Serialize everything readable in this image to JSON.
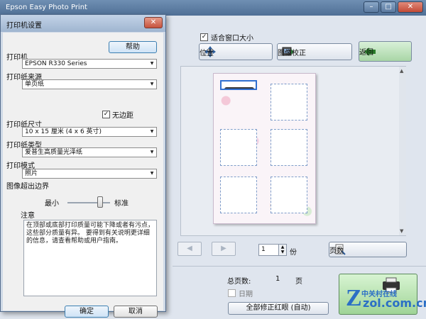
{
  "app": {
    "title": "Epson Easy Photo Print",
    "window_buttons": {
      "minimize": "–",
      "maximize": "□",
      "close": "✕"
    }
  },
  "toolbar": {
    "fit_window_label": "适合窗口大小",
    "fit_window_checked": "✓",
    "position_label": "位置",
    "correct_label": "图像校正",
    "back_label": "返回"
  },
  "navigation": {
    "prev_arrow": "◀",
    "next_arrow": "▶",
    "copies_value": "1",
    "copies_unit": "份",
    "pages_label": "页数"
  },
  "summary": {
    "total_pages_label": "总页数:",
    "total_pages_value": "1",
    "total_pages_unit": "页",
    "date_label": "日期",
    "redeye_label": "全部修正红眼 (自动)"
  },
  "watermark": {
    "brand_cn": "中关村在线",
    "domain": "zol.com.cn",
    "logo_letter": "Z"
  },
  "dialog": {
    "title": "打印机设置",
    "close": "✕",
    "help_label": "帮助",
    "printer_label": "打印机",
    "printer_value": "EPSON R330 Series",
    "source_label": "打印纸来源",
    "source_value": "单页纸",
    "borderless_label": "无边距",
    "borderless_checked": "✓",
    "paper_size_label": "打印纸尺寸",
    "paper_size_value": "10 x 15 厘米 (4 x 6 英寸)",
    "paper_type_label": "打印纸类型",
    "paper_type_value": "爱普生高质量光泽纸",
    "print_mode_label": "打印模式",
    "print_mode_value": "照片",
    "expansion_label": "图像超出边界",
    "expansion_min": "最小",
    "expansion_std": "标准",
    "notes_label": "注意",
    "notes_text": "在顶部或底部打印质量可能下降或者有污点，这些部分质量有异。 要得到有关说明更详细的信息，请查看帮助或用户指南。",
    "ok_label": "确定",
    "cancel_label": "取消"
  },
  "colors": {
    "selection_border": "#2f6fd0",
    "slot_border": "#7f9cc9",
    "back_button": "#a9d6a6",
    "title_bar": "#4f6f95"
  },
  "icons": [
    "move-icon",
    "image-correct-icon",
    "back-arrow-icon",
    "pages-icon",
    "dropdown-arrow-icon",
    "checkbox-icon",
    "printer-icon"
  ]
}
